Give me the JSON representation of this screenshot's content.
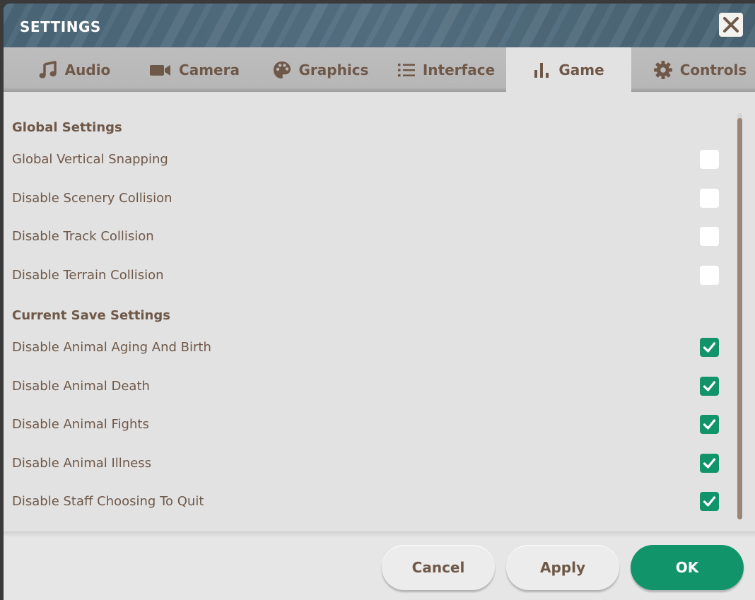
{
  "window": {
    "title": "SETTINGS"
  },
  "tabs": [
    {
      "key": "audio",
      "label": "Audio",
      "icon": "music-note-icon",
      "active": false
    },
    {
      "key": "camera",
      "label": "Camera",
      "icon": "video-camera-icon",
      "active": false
    },
    {
      "key": "graphics",
      "label": "Graphics",
      "icon": "palette-icon",
      "active": false
    },
    {
      "key": "interface",
      "label": "Interface",
      "icon": "list-icon",
      "active": false
    },
    {
      "key": "game",
      "label": "Game",
      "icon": "bar-chart-icon",
      "active": true
    },
    {
      "key": "controls",
      "label": "Controls",
      "icon": "gear-icon",
      "active": false
    }
  ],
  "sections": {
    "global": {
      "heading": "Global Settings",
      "items": [
        {
          "label": "Global Vertical Snapping",
          "checked": false
        },
        {
          "label": "Disable Scenery Collision",
          "checked": false
        },
        {
          "label": "Disable Track Collision",
          "checked": false
        },
        {
          "label": "Disable Terrain Collision",
          "checked": false
        }
      ]
    },
    "current_save": {
      "heading": "Current Save Settings",
      "items": [
        {
          "label": "Disable Animal Aging And Birth",
          "checked": true
        },
        {
          "label": "Disable Animal Death",
          "checked": true
        },
        {
          "label": "Disable Animal Fights",
          "checked": true
        },
        {
          "label": "Disable Animal Illness",
          "checked": true
        },
        {
          "label": "Disable Staff Choosing To Quit",
          "checked": true
        }
      ]
    }
  },
  "footer": {
    "cancel_label": "Cancel",
    "apply_label": "Apply",
    "ok_label": "OK"
  },
  "colors": {
    "accent": "#12946a",
    "text": "#6f5848",
    "title_bar": "#506c7d",
    "panel": "#e2e2e2"
  }
}
